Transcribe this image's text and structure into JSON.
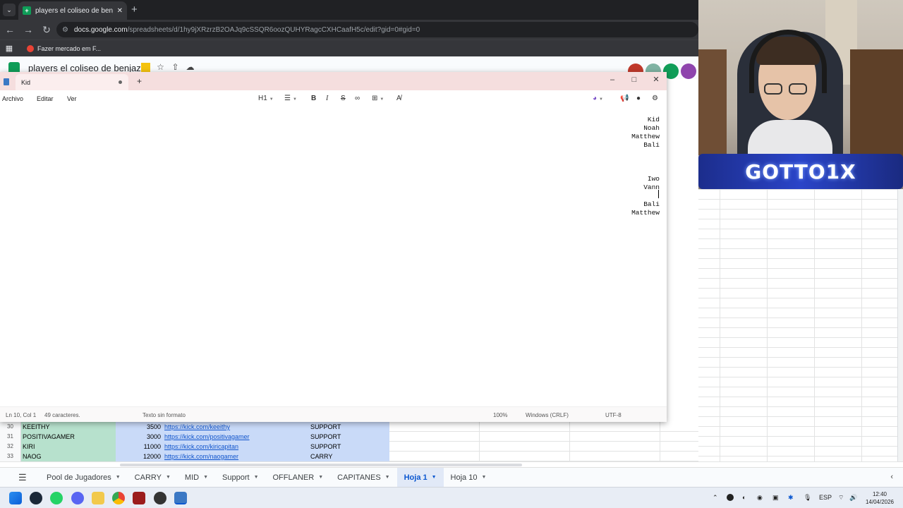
{
  "chrome": {
    "tab_title": "players el coliseo de benjaz - H",
    "url_host": "docs.google.com",
    "url_path": "/spreadsheets/d/1hy9jXRzrzB2OAJq9cSSQR6oozQUHYRagcCXHCaafH5c/edit?gid=0#gid=0",
    "bookmark": "Fazer mercado em F..."
  },
  "sheets": {
    "doc_title": "players el coliseo de benjaz",
    "rows": [
      {
        "num": "30",
        "name": "KEEITHY",
        "mmr": "3500",
        "link": "https://kick.com/keeithy",
        "role": "SUPPORT"
      },
      {
        "num": "31",
        "name": "POSITIVAGAMER",
        "mmr": "3000",
        "link": "https://kick.com/positivagamer",
        "role": "SUPPORT"
      },
      {
        "num": "32",
        "name": "KIRI",
        "mmr": "11000",
        "link": "https://kick.com/kiricapitan",
        "role": "SUPPORT"
      },
      {
        "num": "33",
        "name": "NAOG",
        "mmr": "12000",
        "link": "https://kick.com/naogamer",
        "role": "CARRY"
      }
    ],
    "tabs": [
      {
        "label": "Pool de Jugadores",
        "active": false
      },
      {
        "label": "CARRY",
        "active": false
      },
      {
        "label": "MID",
        "active": false
      },
      {
        "label": "Support",
        "active": false
      },
      {
        "label": "OFFLANER",
        "active": false
      },
      {
        "label": "CAPITANES",
        "active": false
      },
      {
        "label": "Hoja 1",
        "active": true
      },
      {
        "label": "Hoja 10",
        "active": false
      }
    ]
  },
  "notepad": {
    "tab_title": "Kid",
    "menus": [
      "Archivo",
      "Editar",
      "Ver"
    ],
    "heading_select": "H1",
    "lines": [
      "Kid",
      "Noah",
      "Matthew",
      "Bali",
      "",
      "",
      "",
      "Iwo",
      "Vann",
      "",
      "Bali",
      "Matthew"
    ],
    "status": {
      "position": "Ln 10, Col 1",
      "chars": "49 caracteres.",
      "format": "Texto sin formato",
      "zoom": "100%",
      "line_endings": "Windows (CRLF)",
      "encoding": "UTF-8"
    }
  },
  "webcam": {
    "banner": "GOTTO1X"
  },
  "taskbar": {
    "lang": "ESP",
    "time": "12:40",
    "date": "14/04/2026"
  }
}
